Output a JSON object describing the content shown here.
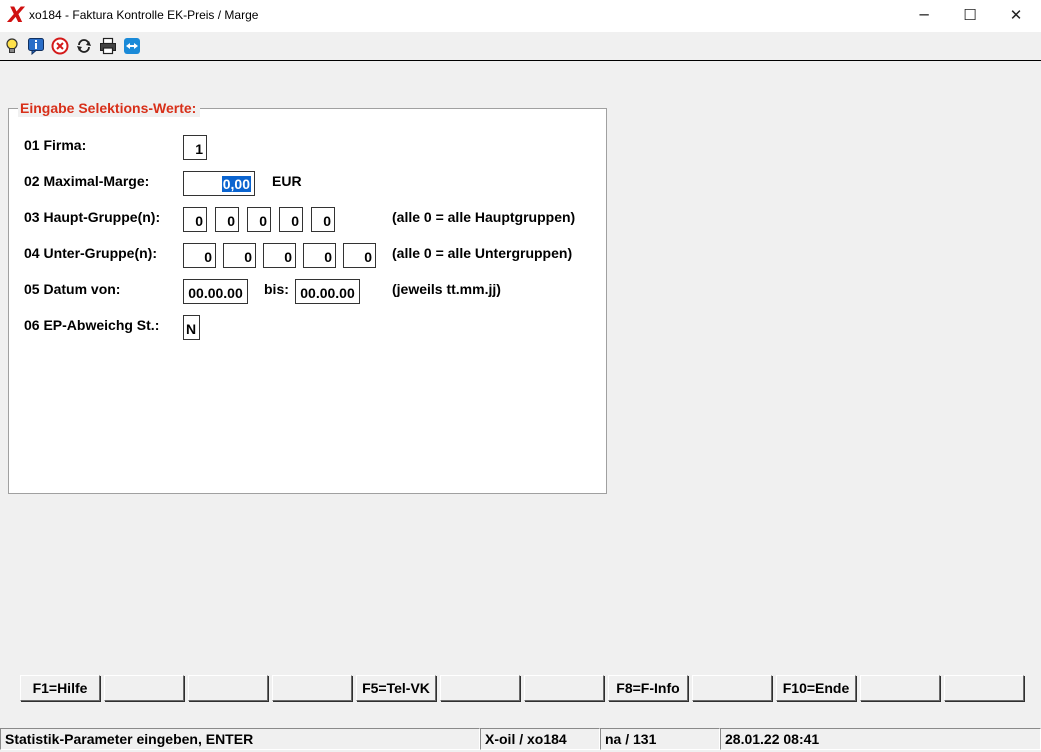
{
  "window": {
    "title": "xo184 - Faktura Kontrolle EK-Preis / Marge",
    "logo": "X",
    "minimize": "─",
    "maximize": "☐",
    "close": "✕"
  },
  "toolbar": {
    "icons": [
      "lightbulb-icon",
      "info-icon",
      "stop-icon",
      "refresh-icon",
      "printer-icon",
      "teamviewer-icon"
    ]
  },
  "form": {
    "legend": "Eingabe Selektions-Werte:",
    "firma": {
      "label": "01 Firma:",
      "value": "1"
    },
    "marge": {
      "label": "02 Maximal-Marge:",
      "value": "0,00",
      "unit": "EUR"
    },
    "hauptgruppen": {
      "label": "03 Haupt-Gruppe(n):",
      "values": [
        "0",
        "0",
        "0",
        "0",
        "0"
      ],
      "hint": "(alle 0 = alle Hauptgruppen)"
    },
    "untergruppen": {
      "label": "04 Unter-Gruppe(n):",
      "values": [
        "0",
        "0",
        "0",
        "0",
        "0"
      ],
      "hint": "(alle 0 = alle Untergruppen)"
    },
    "datum": {
      "label": "05 Datum von:",
      "from": "00.00.00",
      "bis_label": "bis:",
      "to": "00.00.00",
      "hint": "(jeweils tt.mm.jj)"
    },
    "ep_abweichung": {
      "label": "06 EP-Abweichg St.:",
      "value": "N"
    }
  },
  "function_keys": [
    "F1=Hilfe",
    "",
    "",
    "",
    "F5=Tel-VK",
    "",
    "",
    "F8=F-Info",
    "",
    "F10=Ende",
    "",
    ""
  ],
  "status": {
    "message": "Statistik-Parameter eingeben, ENTER",
    "program": "X-oil / xo184",
    "user": "na / 131",
    "datetime": "28.01.22 08:41"
  },
  "colors": {
    "legend": "#d8301a",
    "selection": "#0a64d0",
    "logo": "#d01010"
  }
}
